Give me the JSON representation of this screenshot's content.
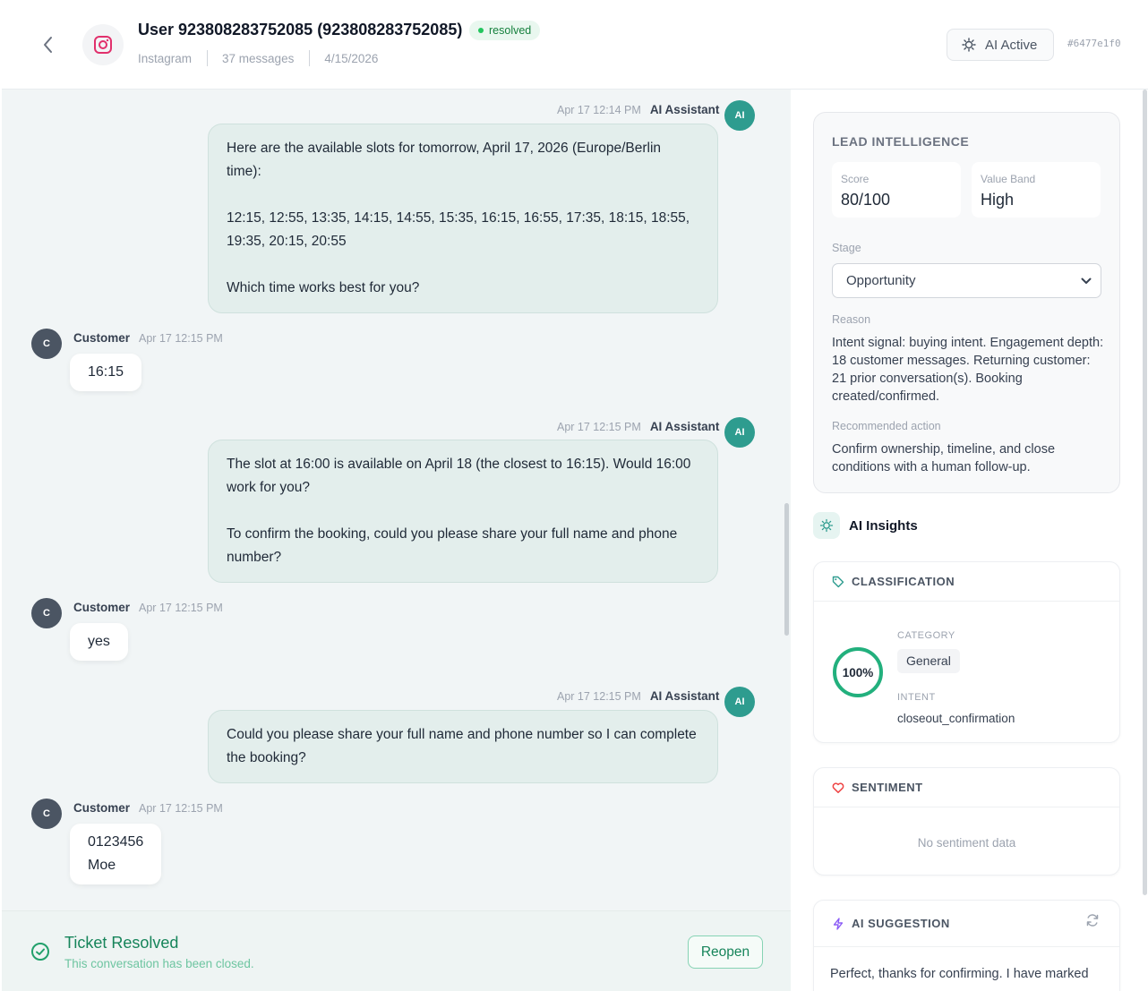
{
  "header": {
    "title": "User 923808283752085 (923808283752085)",
    "status": "resolved",
    "channel": "Instagram",
    "messages_count": "37 messages",
    "date": "4/15/2026",
    "ai_toggle_label": "AI Active",
    "conversation_id": "#6477e1f0"
  },
  "messages": [
    {
      "sender": "AI Assistant",
      "time": "Apr 17 12:14 PM",
      "avatar": "AI",
      "text": "Here are the available slots for tomorrow, April 17, 2026 (Europe/Berlin time):\n\n12:15, 12:55, 13:35, 14:15, 14:55, 15:35, 16:15, 16:55, 17:35, 18:15, 18:55, 19:35, 20:15, 20:55\n\nWhich time works best for you?"
    },
    {
      "sender": "Customer",
      "time": "Apr 17 12:15 PM",
      "avatar": "C",
      "text": "16:15"
    },
    {
      "sender": "AI Assistant",
      "time": "Apr 17 12:15 PM",
      "avatar": "AI",
      "text": "The slot at 16:00 is available on April 18 (the closest to 16:15). Would 16:00 work for you?\n\nTo confirm the booking, could you please share your full name and phone number?"
    },
    {
      "sender": "Customer",
      "time": "Apr 17 12:15 PM",
      "avatar": "C",
      "text": "yes"
    },
    {
      "sender": "AI Assistant",
      "time": "Apr 17 12:15 PM",
      "avatar": "AI",
      "text": "Could you please share your full name and phone number so I can complete the booking?"
    },
    {
      "sender": "Customer",
      "time": "Apr 17 12:15 PM",
      "avatar": "C",
      "text": "0123456\nMoe"
    }
  ],
  "resolved_banner": {
    "title": "Ticket Resolved",
    "subtitle": "This conversation has been closed.",
    "reopen_label": "Reopen"
  },
  "lead": {
    "heading": "LEAD INTELLIGENCE",
    "score_label": "Score",
    "score_value": "80/100",
    "band_label": "Value Band",
    "band_value": "High",
    "stage_label": "Stage",
    "stage_value": "Opportunity",
    "reason_label": "Reason",
    "reason_text": "Intent signal: buying intent. Engagement depth: 18 customer messages. Returning customer: 21 prior conversation(s). Booking created/confirmed.",
    "action_label": "Recommended action",
    "action_text": "Confirm ownership, timeline, and close conditions with a human follow-up."
  },
  "insights": {
    "title": "AI Insights",
    "classification": {
      "heading": "CLASSIFICATION",
      "confidence": 1.0,
      "confidence_label": "100%",
      "category_label": "CATEGORY",
      "category_value": "General",
      "intent_label": "INTENT",
      "intent_value": "closeout_confirmation"
    },
    "sentiment": {
      "heading": "SENTIMENT",
      "empty_text": "No sentiment data"
    },
    "suggestion": {
      "heading": "AI SUGGESTION",
      "text": "Perfect, thanks for confirming. I have marked"
    }
  },
  "colors": {
    "accent": "#2e9c8f",
    "resolved": "#16845a",
    "instagram": "#e1306c",
    "sentiment": "#ef4444",
    "suggestion": "#8b5cf6"
  }
}
